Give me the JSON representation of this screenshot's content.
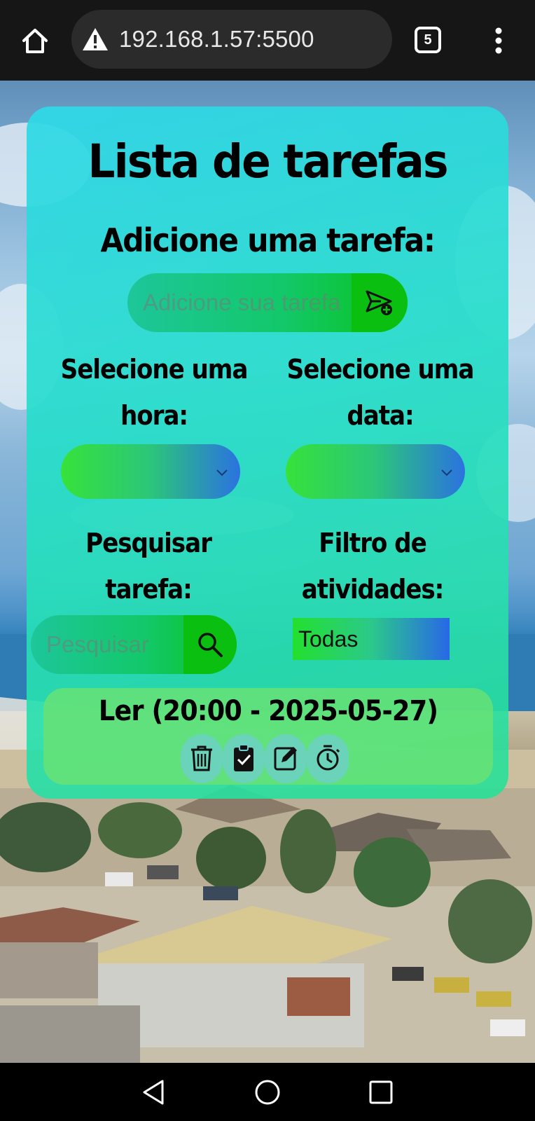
{
  "browser": {
    "url": "192.168.1.57:5500",
    "tab_count": "5",
    "icons": [
      "home-icon",
      "warning-icon",
      "tabs-icon",
      "more-vert-icon"
    ]
  },
  "app": {
    "title": "Lista de tarefas",
    "add_section": {
      "heading": "Adicione uma tarefa:",
      "input_placeholder": "Adicione sua tarefa",
      "submit_icon": "send-add-icon"
    },
    "hour_select": {
      "label_line1": "Selecione uma",
      "label_line2": "hora:",
      "value": ""
    },
    "date_select": {
      "label_line1": "Selecione uma",
      "label_line2": "data:",
      "value": ""
    },
    "search": {
      "label_line1": "Pesquisar",
      "label_line2": "tarefa:",
      "placeholder": "Pesquisar",
      "icon": "search-icon"
    },
    "filter": {
      "label_line1": "Filtro de",
      "label_line2": "atividades:",
      "value": "Todas"
    },
    "tasks": [
      {
        "text": "Ler (20:00 - 2025-05-27)",
        "actions": [
          "trash-icon",
          "clipboard-check-icon",
          "edit-icon",
          "alarm-icon"
        ]
      }
    ]
  },
  "system_nav": [
    "back-icon",
    "home-circle-icon",
    "recents-icon"
  ]
}
